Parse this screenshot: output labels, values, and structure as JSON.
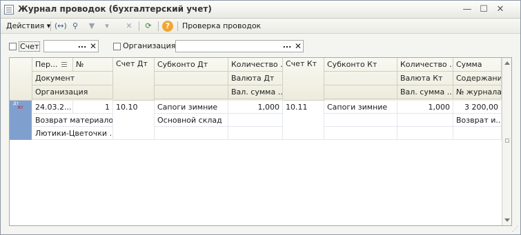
{
  "window": {
    "title": "Журнал проводок (бухгалтерский учет)"
  },
  "toolbar": {
    "actions_label": "Действия",
    "check_label": "Проверка проводок",
    "help_glyph": "?"
  },
  "filter": {
    "account_label": "Счет",
    "organization_label": "Организация:",
    "ellipsis": "...",
    "clear_glyph": "✕"
  },
  "grid": {
    "headers": {
      "period": "Пер...",
      "num": "№",
      "doc": "Документ",
      "org": "Организация",
      "acct_dt": "Счет Дт",
      "sub_dt": "Субконто Дт",
      "qty_dt": "Количество ...",
      "cur_dt": "Валюта Дт",
      "cur_sum_dt": "Вал. сумма ...",
      "acct_kt": "Счет Кт",
      "sub_kt": "Субконто Кт",
      "qty_kt": "Количество ...",
      "cur_kt": "Валюта Кт",
      "cur_sum_kt": "Вал. сумма ...",
      "sum": "Сумма",
      "content": "Содержание",
      "journal": "№ журнала"
    },
    "row": {
      "icon_dt": "Дт",
      "icon_kt": "Кт",
      "period": "24.03.2...",
      "num": "1",
      "document": "Возврат материало...",
      "organization": "Лютики-Цветочки ...",
      "acct_dt": "10.10",
      "sub_dt": "Сапоги зимние",
      "sub_dt_2": "Основной склад",
      "qty_dt": "1,000",
      "acct_kt": "10.11",
      "sub_kt": "Сапоги зимние",
      "qty_kt": "1,000",
      "sum": "3 200,00",
      "content": "Возврат и..."
    }
  }
}
